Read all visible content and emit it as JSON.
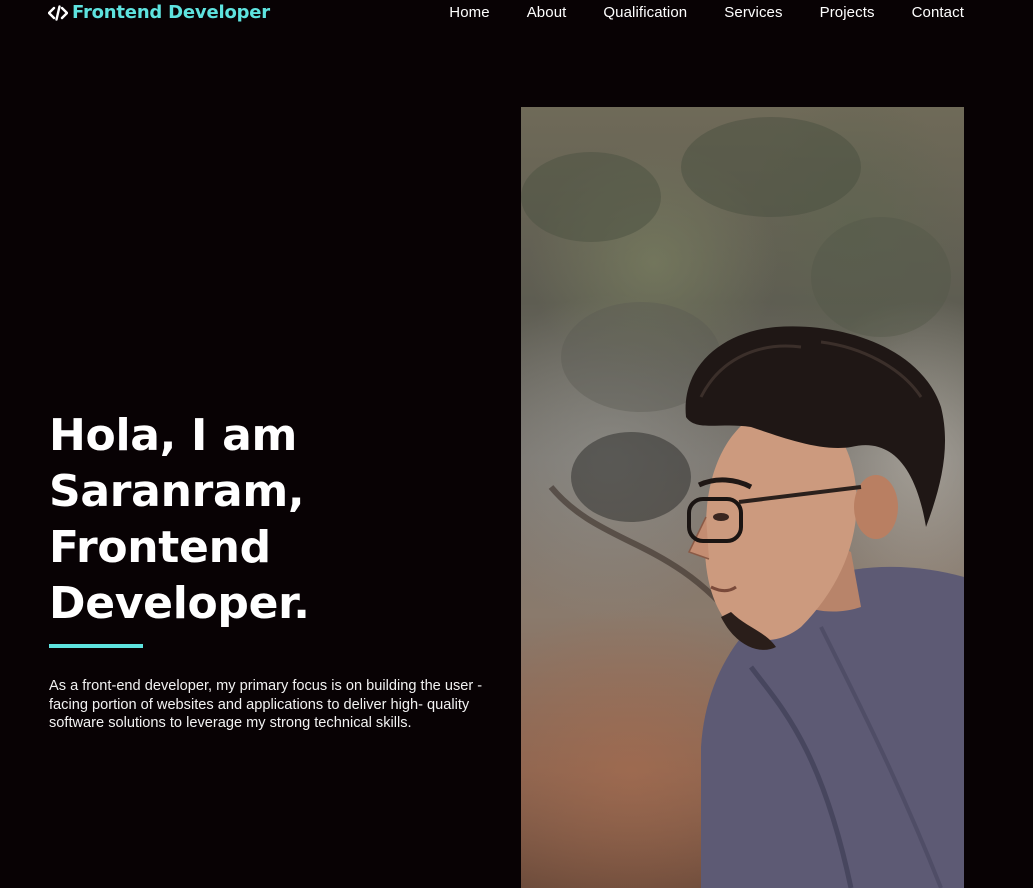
{
  "brand": {
    "logo_text": "Frontend Developer",
    "icon": "code-icon",
    "accent_color": "#5ee3df",
    "background_color": "#080204"
  },
  "nav": {
    "items": [
      {
        "label": "Home"
      },
      {
        "label": "About"
      },
      {
        "label": "Qualification"
      },
      {
        "label": "Services"
      },
      {
        "label": "Projects"
      },
      {
        "label": "Contact"
      }
    ]
  },
  "hero": {
    "title_lines": [
      "Hola, I am",
      "Saranram,",
      "Frontend",
      "Developer."
    ],
    "description": "As a front-end developer, my primary focus is on building the user - facing portion of websites and applications to deliver high- quality software solutions to leverage my strong technical skills.",
    "photo": "profile-portrait-image"
  }
}
